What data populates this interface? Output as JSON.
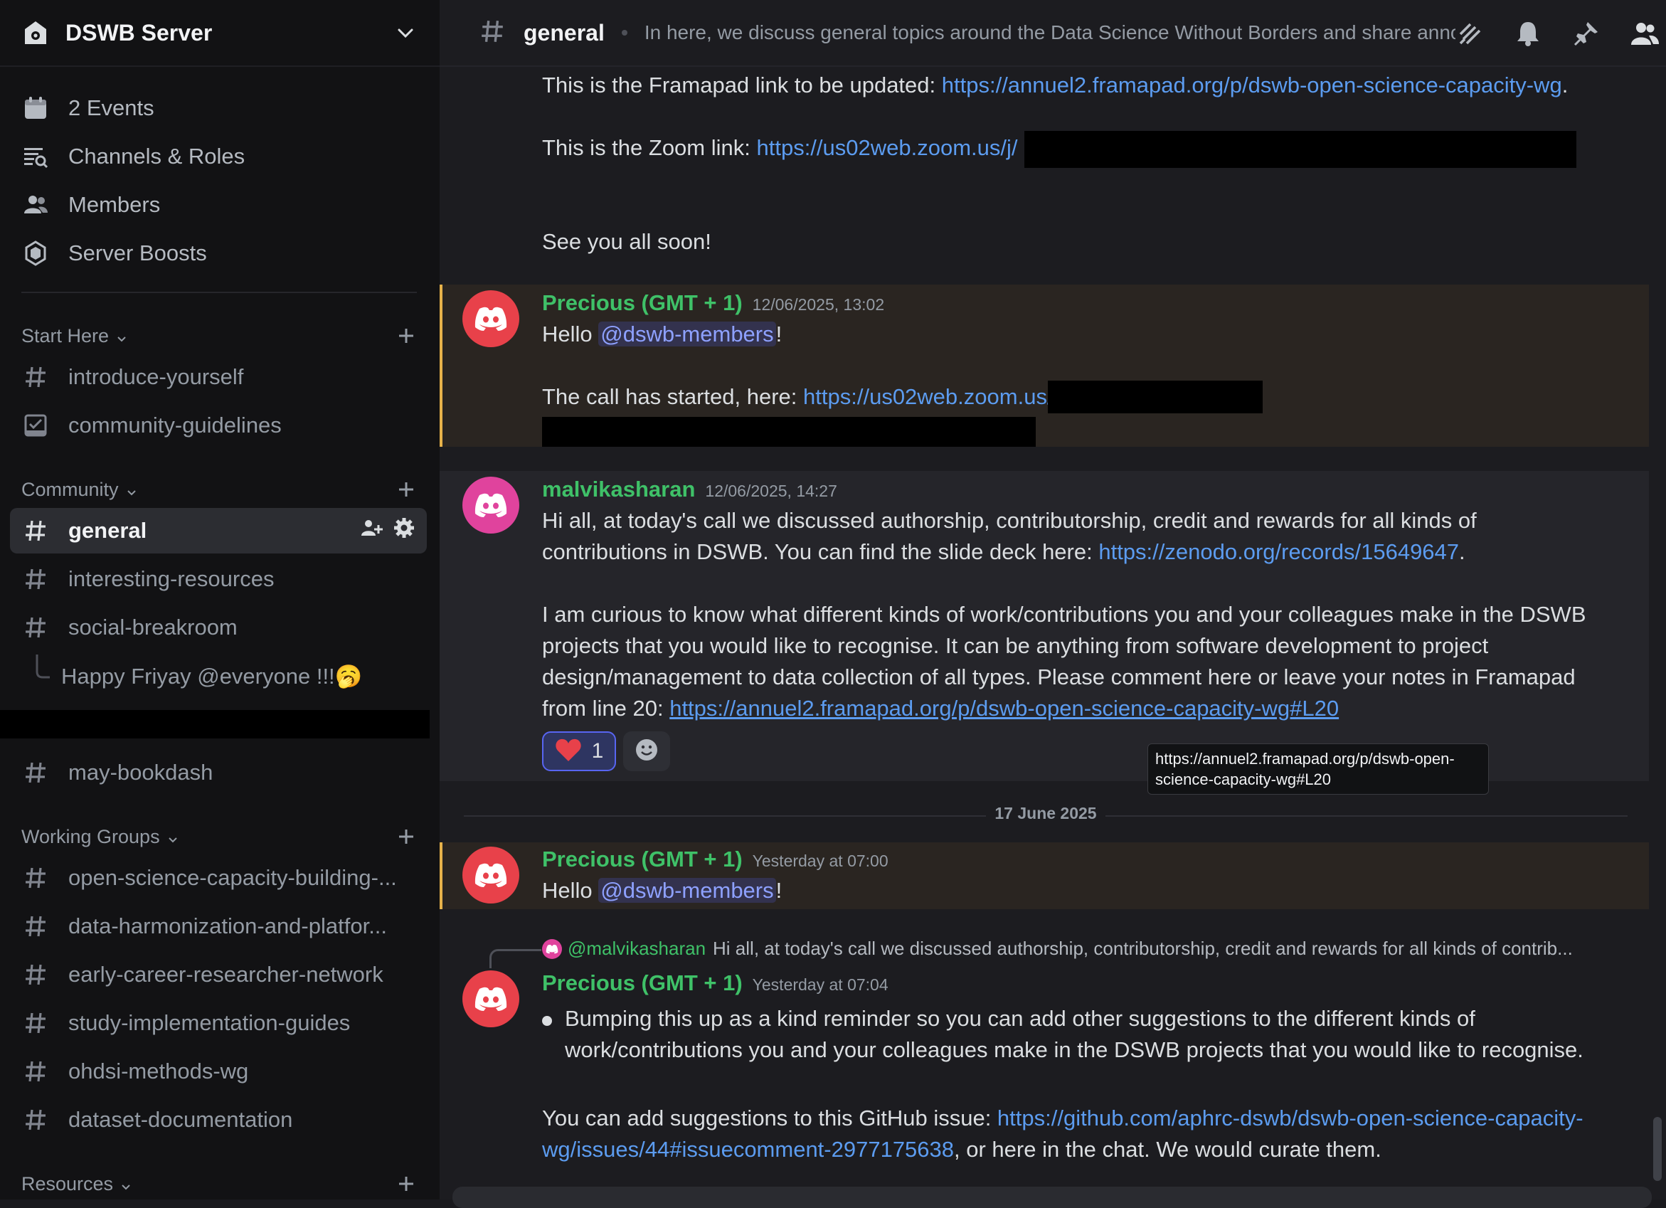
{
  "server": {
    "name": "DSWB Server"
  },
  "menu": [
    {
      "label": "2 Events",
      "icon": "calendar-icon"
    },
    {
      "label": "Channels & Roles",
      "icon": "channel-browse-icon"
    },
    {
      "label": "Members",
      "icon": "members-icon"
    },
    {
      "label": "Server Boosts",
      "icon": "boost-icon"
    }
  ],
  "categories": {
    "start_here": "Start Here",
    "community": "Community",
    "working_groups": "Working Groups",
    "resources": "Resources"
  },
  "channels": {
    "start_here": [
      "introduce-yourself",
      "community-guidelines"
    ],
    "community": [
      "general",
      "interesting-resources",
      "social-breakroom"
    ],
    "thread": "Happy Friyay @everyone !!!🥱",
    "extra": "may-bookdash",
    "working_groups": [
      "open-science-capacity-building-...",
      "data-harmonization-and-platfor...",
      "early-career-researcher-network",
      "study-implementation-guides",
      "ohdsi-methods-wg",
      "dataset-documentation"
    ]
  },
  "topbar": {
    "channel": "general",
    "topic": "In here, we discuss general topics around the Data Science Without Borders and share annou..."
  },
  "messages": {
    "m0": {
      "framapad_prefix": "This is the Framapad link to be updated: ",
      "framapad_link": "https://annuel2.framapad.org/p/dswb-open-science-capacity-wg",
      "framapad_suffix": ".",
      "zoom_prefix": "This is the Zoom link: ",
      "zoom_link": "https://us02web.zoom.us/j/",
      "closing": "See you all soon!"
    },
    "m1": {
      "author": "Precious (GMT + 1)",
      "time": "12/06/2025, 13:02",
      "hello": "Hello ",
      "mention": "@dswb-members",
      "excl": "!",
      "call_prefix": "The call has started, here: ",
      "call_link": "https://us02web.zoom.us/"
    },
    "m2": {
      "author": "malvikasharan",
      "time": "12/06/2025, 14:27",
      "l1": "Hi all, at today's call we discussed authorship, contributorship, credit and rewards for all kinds of",
      "l2_prefix": "contributions in DSWB. You can find the slide deck here: ",
      "l2_link": "https://zenodo.org/records/15649647",
      "l2_suffix": ".",
      "l3": "I am curious to know what different kinds of work/contributions you and your colleagues make in the DSWB",
      "l4": "projects that you would like to recognise. It can be anything from software development to project",
      "l5": "design/management to data collection of all types. Please comment here or leave your notes in Framapad",
      "l6_prefix": "from line 20: ",
      "l6_link": "https://annuel2.framapad.org/p/dswb-open-science-capacity-wg#L20",
      "reaction_count": "1",
      "tooltip": "https://annuel2.framapad.org/p/dswb-open-science-capacity-wg#L20"
    },
    "divider": "17 June 2025",
    "m3": {
      "author": "Precious (GMT + 1)",
      "time": "Yesterday at 07:00",
      "hello": "Hello ",
      "mention": "@dswb-members",
      "excl": "!"
    },
    "m4": {
      "reply_author": "@malvikasharan",
      "reply_text": "Hi all, at today's call we discussed authorship, contributorship, credit and rewards for all kinds of contrib...",
      "author": "Precious (GMT + 1)",
      "time": "Yesterday at 07:04",
      "b1": "Bumping this up as a kind reminder so you can add other suggestions to the different kinds of",
      "b2": "work/contributions you and your colleagues make in the DSWB projects that you would like to recognise.",
      "gh_prefix": "You can add suggestions to this GitHub issue: ",
      "gh_link1": "https://github.com/aphrc-dswb/dswb-open-science-capacity-",
      "gh_link2": "wg/issues/44#issuecomment-2977175638",
      "gh_suffix": ", or here in the chat. We would curate them."
    }
  },
  "colors": {
    "accent_green": "#3fc168",
    "link": "#5c9cf0",
    "highlight_bar": "#e6b24a",
    "avatar_red": "#e8414a",
    "avatar_pink": "#e0439d"
  }
}
